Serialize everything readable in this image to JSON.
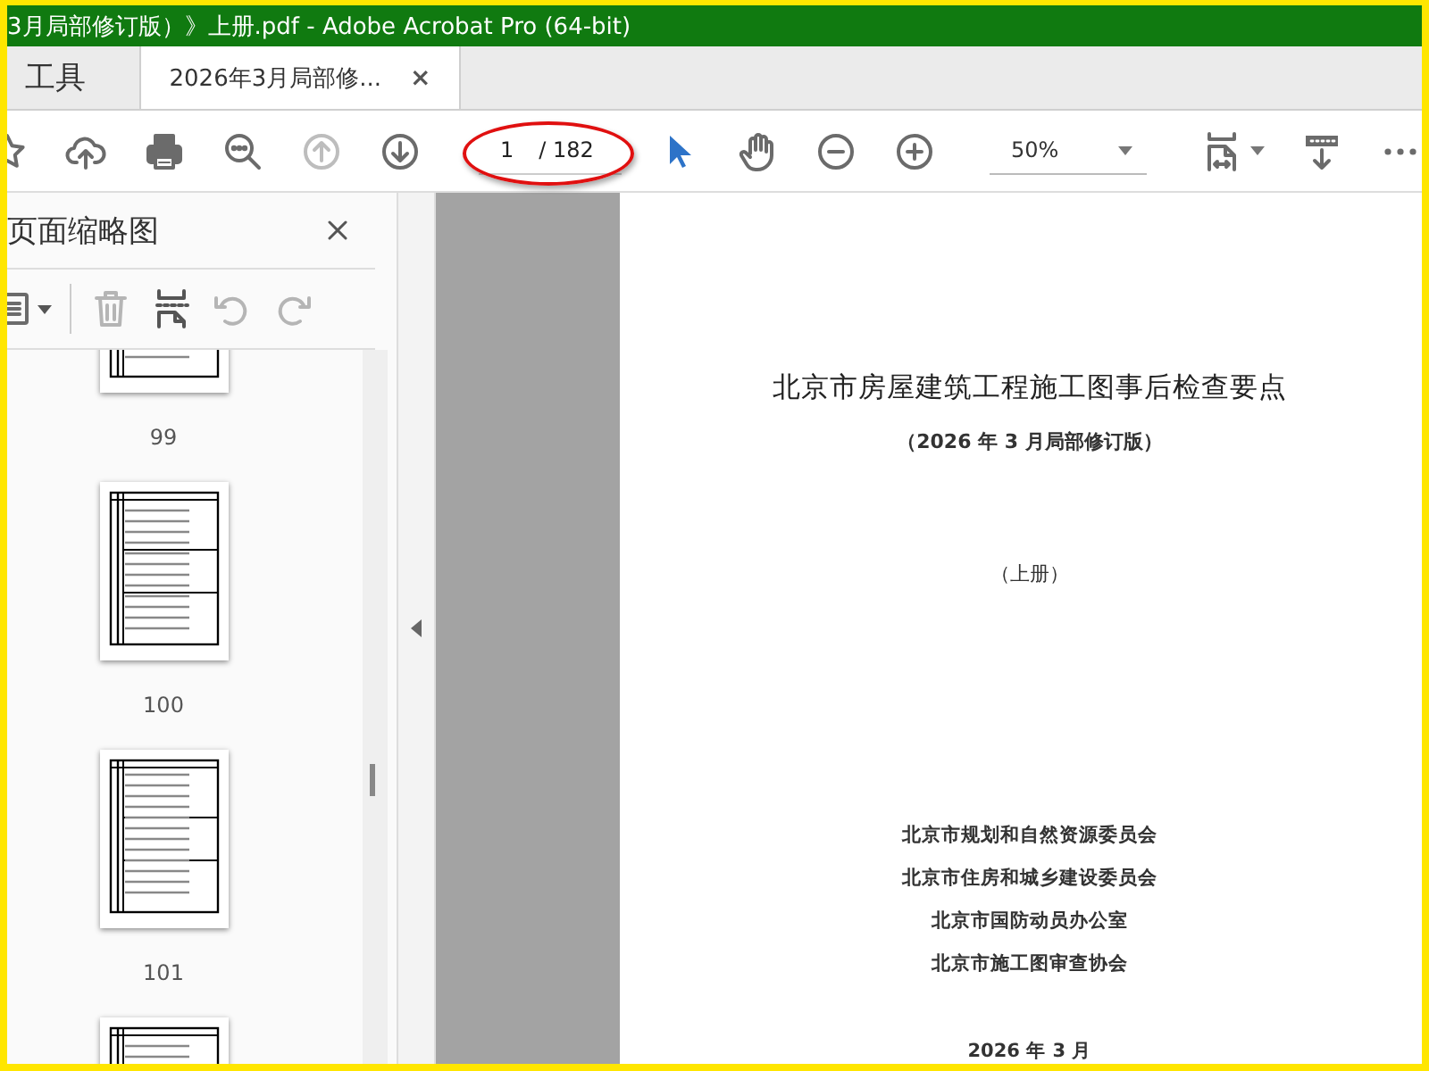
{
  "window": {
    "title": "3月局部修订版）》上册.pdf - Adobe Acrobat Pro (64-bit)"
  },
  "tabs": [
    {
      "label": "工具",
      "selected": false
    },
    {
      "label": "2026年3月局部修...",
      "selected": true,
      "close": "×"
    }
  ],
  "toolbar": {
    "previous_disabled": true,
    "next_disabled": false,
    "page": "1",
    "page_total": "/ 182",
    "select_tool_active": true,
    "zoom": "50%"
  },
  "annotation": {
    "highlight_ellipse": true
  },
  "panel": {
    "title": "页面缩略图"
  },
  "thumbnails": [
    {
      "label": "99"
    },
    {
      "label": "100"
    },
    {
      "label": "101"
    }
  ],
  "document": {
    "title": "北京市房屋建筑工程施工图事后检查要点",
    "subtitle": "（2026 年 3 月局部修订版）",
    "volume": "（上册）",
    "organizations": [
      "北京市规划和自然资源委员会",
      "北京市住房和城乡建设委员会",
      "北京市国防动员办公室",
      "北京市施工图审查协会"
    ],
    "date": "2026 年 3 月"
  }
}
